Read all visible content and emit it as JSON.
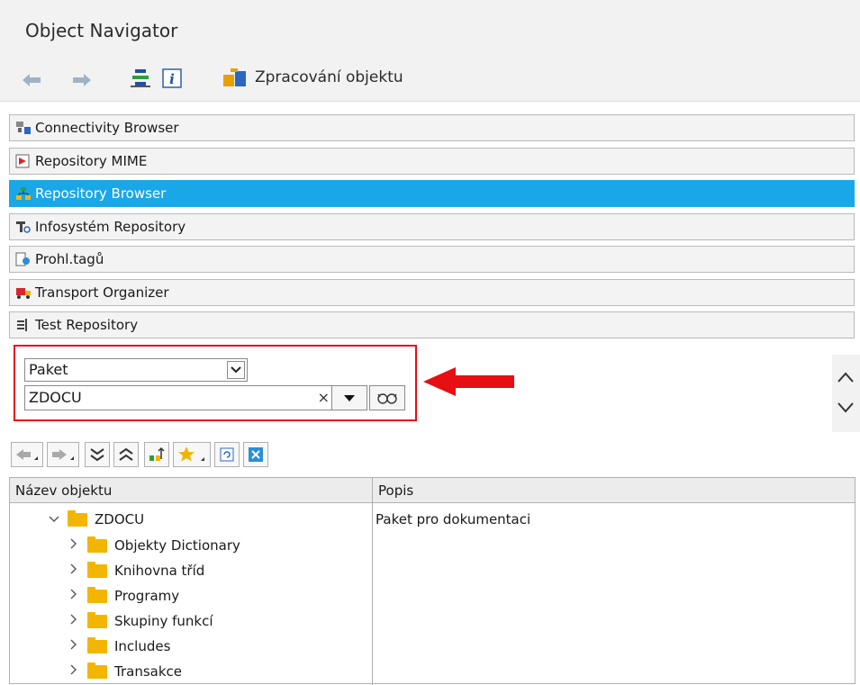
{
  "window": {
    "title": "Object Navigator"
  },
  "toolbar": {
    "back_icon": "arrow-left-icon",
    "forward_icon": "arrow-right-icon",
    "hierarchy_icon": "hierarchy-icon",
    "info_icon": "info-icon",
    "edit_object_label": "Zpracování objektu"
  },
  "nav": {
    "items": [
      {
        "label": "Connectivity Browser",
        "icon": "connectivity-icon"
      },
      {
        "label": "Repository MIME",
        "icon": "mime-icon"
      },
      {
        "label": "Repository Browser",
        "icon": "repository-browser-icon",
        "active": true
      },
      {
        "label": "Infosystém Repository",
        "icon": "infosystem-icon"
      },
      {
        "label": "Prohl.tagů",
        "icon": "tag-browser-icon"
      },
      {
        "label": "Transport Organizer",
        "icon": "truck-icon"
      },
      {
        "label": "Test Repository",
        "icon": "test-icon"
      }
    ]
  },
  "selector": {
    "type_value": "Paket",
    "object_value": "ZDOCU",
    "clear_symbol": "×"
  },
  "colors": {
    "accent": "#1aa7e8",
    "highlight": "#e60f13",
    "folder": "#f2b600"
  },
  "tree": {
    "columns": [
      "Název objektu",
      "Popis"
    ],
    "root": {
      "name": "ZDOCU",
      "desc": "Paket pro dokumentaci"
    },
    "children": [
      "Objekty Dictionary",
      "Knihovna tříd",
      "Programy",
      "Skupiny funkcí",
      "Includes",
      "Transakce"
    ]
  }
}
